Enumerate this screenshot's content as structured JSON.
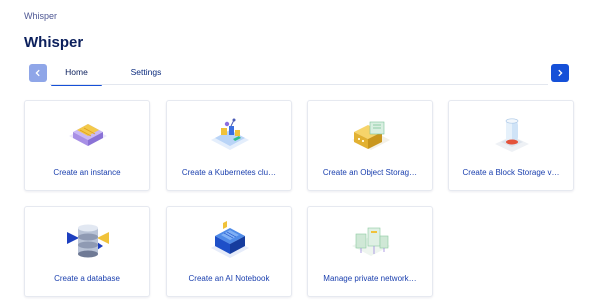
{
  "breadcrumb": "Whisper",
  "page_title": "Whisper",
  "tabs": [
    {
      "label": "Home",
      "active": true
    },
    {
      "label": "Settings",
      "active": false
    }
  ],
  "cards": [
    {
      "label": "Create an instance",
      "icon": "instance-illustration-icon"
    },
    {
      "label": "Create a Kubernetes clu…",
      "icon": "kubernetes-illustration-icon"
    },
    {
      "label": "Create an Object Storag…",
      "icon": "object-storage-illustration-icon"
    },
    {
      "label": "Create a Block Storage v…",
      "icon": "block-storage-illustration-icon"
    },
    {
      "label": "Create a database",
      "icon": "database-illustration-icon"
    },
    {
      "label": "Create an AI Notebook",
      "icon": "ai-notebook-illustration-icon"
    },
    {
      "label": "Manage private network…",
      "icon": "private-network-illustration-icon"
    }
  ],
  "colors": {
    "accent": "#1550d8",
    "accent_disabled": "#8fa6e8",
    "title": "#0b1f5c",
    "link": "#1a3fae"
  }
}
